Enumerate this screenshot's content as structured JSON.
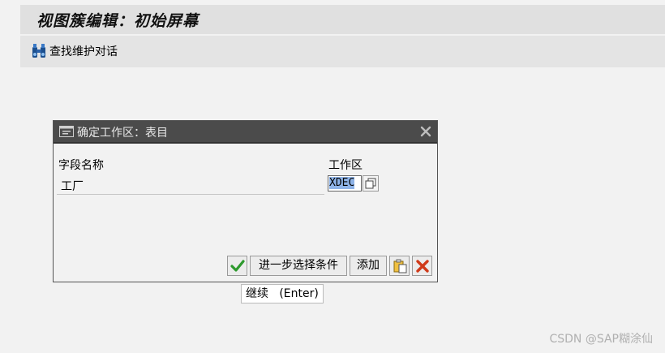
{
  "header": {
    "title": "视图簇编辑：初始屏幕"
  },
  "toolbar": {
    "find_label": "查找维护对话"
  },
  "dialog": {
    "title": "确定工作区：表目",
    "columns": {
      "field_name": "字段名称",
      "workarea": "工作区"
    },
    "row": {
      "label": "工厂",
      "value": "XDEC"
    },
    "buttons": {
      "further_selection": "进一步选择条件",
      "add": "添加"
    }
  },
  "tooltip": {
    "text": "继续   (Enter)"
  },
  "watermark": {
    "text": "CSDN @SAP糊涂仙"
  },
  "colors": {
    "ok_green": "#2e9a2e",
    "cancel_red": "#d03a1a",
    "header_dark": "#4b4b4b"
  }
}
